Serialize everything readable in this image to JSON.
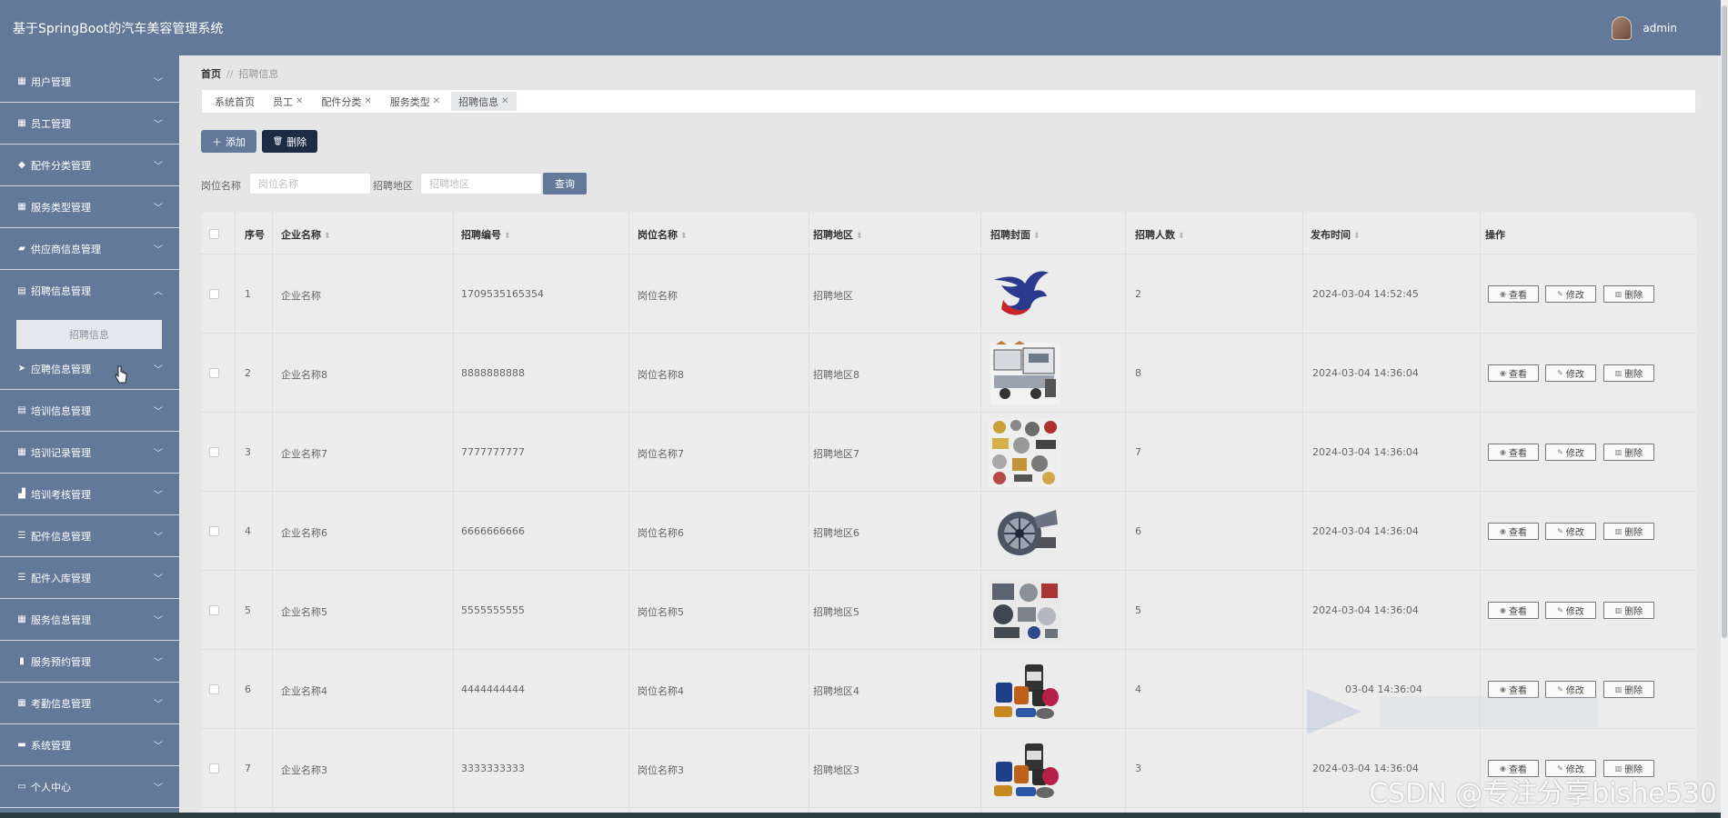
{
  "header": {
    "title": "基于SpringBoot的汽车美容管理系统",
    "user": "admin"
  },
  "sidebar": {
    "items": [
      {
        "label": "用户管理",
        "icon": "grid-icon"
      },
      {
        "label": "员工管理",
        "icon": "grid-icon"
      },
      {
        "label": "配件分类管理",
        "icon": "pin-icon"
      },
      {
        "label": "服务类型管理",
        "icon": "grid-icon"
      },
      {
        "label": "供应商信息管理",
        "icon": "chat-icon"
      },
      {
        "label": "招聘信息管理",
        "icon": "table-icon"
      },
      {
        "label": "应聘信息管理",
        "icon": "send-icon"
      },
      {
        "label": "培训信息管理",
        "icon": "table-icon"
      },
      {
        "label": "培训记录管理",
        "icon": "grid-icon"
      },
      {
        "label": "培训考核管理",
        "icon": "thumb-icon"
      },
      {
        "label": "配件信息管理",
        "icon": "list-icon"
      },
      {
        "label": "配件入库管理",
        "icon": "list-icon"
      },
      {
        "label": "服务信息管理",
        "icon": "grid-icon"
      },
      {
        "label": "服务预约管理",
        "icon": "bar-icon"
      },
      {
        "label": "考勤信息管理",
        "icon": "grid-icon"
      },
      {
        "label": "系统管理",
        "icon": "briefcase-icon"
      },
      {
        "label": "个人中心",
        "icon": "card-icon"
      }
    ],
    "submenu_label": "招聘信息"
  },
  "breadcrumb": {
    "home": "首页",
    "sep": "//",
    "current": "招聘信息"
  },
  "tabs": [
    {
      "label": "系统首页",
      "closable": false
    },
    {
      "label": "员工",
      "closable": true
    },
    {
      "label": "配件分类",
      "closable": true
    },
    {
      "label": "服务类型",
      "closable": true
    },
    {
      "label": "招聘信息",
      "closable": true,
      "active": true
    }
  ],
  "actions": {
    "add": "添加",
    "delete": "删除"
  },
  "search": {
    "position_label": "岗位名称",
    "position_placeholder": "岗位名称",
    "region_label": "招聘地区",
    "region_placeholder": "招聘地区",
    "query": "查询"
  },
  "table": {
    "columns": [
      "序号",
      "企业名称",
      "招聘编号",
      "岗位名称",
      "招聘地区",
      "招聘封面",
      "招聘人数",
      "发布时间",
      "操作"
    ],
    "rows": [
      {
        "seq": "1",
        "company": "企业名称",
        "code": "1709535165354",
        "position": "岗位名称",
        "region": "招聘地区",
        "count": "2",
        "time": "2024-03-04 14:52:45",
        "cover": "bird-logo"
      },
      {
        "seq": "2",
        "company": "企业名称8",
        "code": "8888888888",
        "position": "岗位名称8",
        "region": "招聘地区8",
        "count": "8",
        "time": "2024-03-04 14:36:04",
        "cover": "truck-parts"
      },
      {
        "seq": "3",
        "company": "企业名称7",
        "code": "7777777777",
        "position": "岗位名称7",
        "region": "招聘地区7",
        "count": "7",
        "time": "2024-03-04 14:36:04",
        "cover": "parts-collage"
      },
      {
        "seq": "4",
        "company": "企业名称6",
        "code": "6666666666",
        "position": "岗位名称6",
        "region": "招聘地区6",
        "count": "6",
        "time": "2024-03-04 14:36:04",
        "cover": "turbine"
      },
      {
        "seq": "5",
        "company": "企业名称5",
        "code": "5555555555",
        "position": "岗位名称5",
        "region": "招聘地区5",
        "count": "5",
        "time": "2024-03-04 14:36:04",
        "cover": "engine-parts"
      },
      {
        "seq": "6",
        "company": "企业名称4",
        "code": "4444444444",
        "position": "岗位名称4",
        "region": "招聘地区4",
        "count": "4",
        "time": "03-04 14:36:04",
        "cover": "oil-filters"
      },
      {
        "seq": "7",
        "company": "企业名称3",
        "code": "3333333333",
        "position": "岗位名称3",
        "region": "招聘地区3",
        "count": "3",
        "time": "2024-03-04 14:36:04",
        "cover": "oil-filters"
      }
    ],
    "ops": {
      "view": "查看",
      "edit": "修改",
      "delete": "删除"
    }
  },
  "watermark": "CSDN @专注分享bishe530",
  "colors": {
    "primary": "#63799a",
    "dark": "#1e2b45"
  }
}
